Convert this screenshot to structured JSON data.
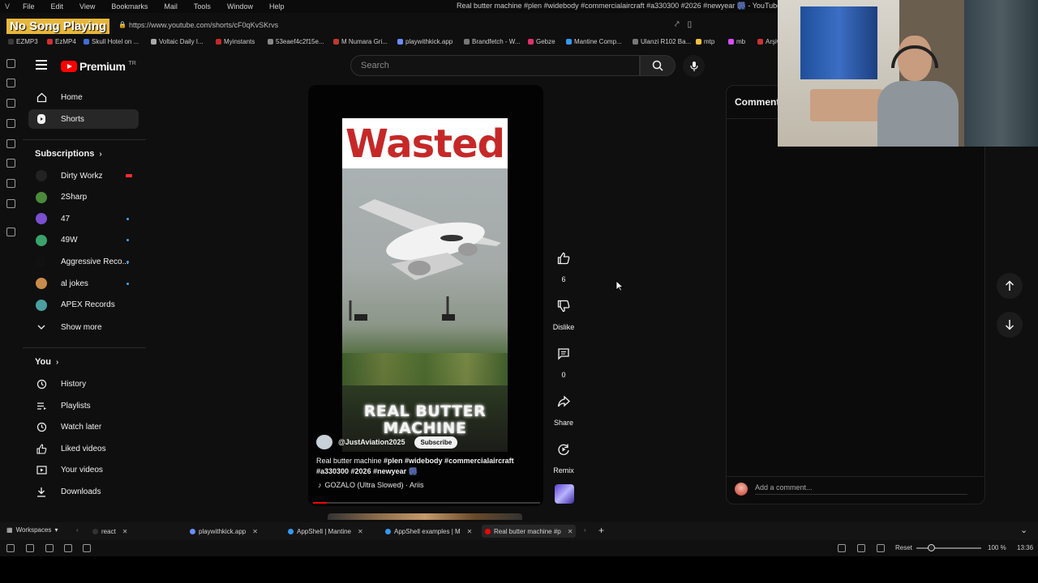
{
  "browser": {
    "menu": [
      "File",
      "Edit",
      "View",
      "Bookmarks",
      "Mail",
      "Tools",
      "Window",
      "Help"
    ],
    "window_title": "Real butter machine #plen #widebody #commercialaircraft #a330300 #2026 #newyear 🎆 - YouTube",
    "url": "https://www.youtube.com/shorts/cF0qKvSKrvs",
    "overlay_badge": "No Song Playing",
    "bookmarks": [
      {
        "label": "EZMP3",
        "color": "#3a3a3a"
      },
      {
        "label": "EzMP4",
        "color": "#d32f2f"
      },
      {
        "label": "Skull Hotel on ...",
        "color": "#3e6fd8"
      },
      {
        "label": "Voltaic Daily I...",
        "color": "#aaaaaa"
      },
      {
        "label": "Myinstants",
        "color": "#c62828"
      },
      {
        "label": "53eaef4c2f15e...",
        "color": "#888888"
      },
      {
        "label": "M Numara Gri...",
        "color": "#c0392b"
      },
      {
        "label": "playwithkick.app",
        "color": "#6a8cff"
      },
      {
        "label": "Brandfetch - W...",
        "color": "#777777"
      },
      {
        "label": "Gebze",
        "color": "#e1306c"
      },
      {
        "label": "Mantine Comp...",
        "color": "#339af0"
      },
      {
        "label": "Ulanzi R102 Ba...",
        "color": "#777777"
      },
      {
        "label": "mtp",
        "color": "#f0c040"
      },
      {
        "label": "mb",
        "color": "#d94dff"
      },
      {
        "label": "Arşiv",
        "color": "#cc3333"
      }
    ]
  },
  "youtube": {
    "logo_text": "Premium",
    "logo_region": "TR",
    "search_placeholder": "Search",
    "nav_main": [
      {
        "label": "Home",
        "icon": "home-icon"
      },
      {
        "label": "Shorts",
        "icon": "shorts-icon"
      }
    ],
    "subscriptions_title": "Subscriptions",
    "subscriptions": [
      {
        "label": "Dirty Workz",
        "color": "#222222",
        "badge": "live"
      },
      {
        "label": "2Sharp",
        "color": "#4a8a3a",
        "badge": ""
      },
      {
        "label": "47",
        "color": "#7a4fd0",
        "badge": "new"
      },
      {
        "label": "49W",
        "color": "#3aa36b",
        "badge": "new"
      },
      {
        "label": "Aggressive Reco...",
        "color": "#111111",
        "badge": "new"
      },
      {
        "label": "al jokes",
        "color": "#c98b4a",
        "badge": "new"
      },
      {
        "label": "APEX Records",
        "color": "#4aa0a0",
        "badge": ""
      }
    ],
    "show_more": "Show more",
    "you_title": "You",
    "you_items": [
      {
        "label": "History",
        "icon": "history-icon"
      },
      {
        "label": "Playlists",
        "icon": "playlists-icon"
      },
      {
        "label": "Watch later",
        "icon": "watch-later-icon"
      },
      {
        "label": "Liked videos",
        "icon": "liked-videos-icon"
      },
      {
        "label": "Your videos",
        "icon": "your-videos-icon"
      },
      {
        "label": "Downloads",
        "icon": "downloads-icon"
      }
    ]
  },
  "short": {
    "overlay_top": "Wasted",
    "overlay_bottom": "REAL BUTTER MACHINE",
    "channel": "@JustAviation2025",
    "subscribe": "Subscribe",
    "title_plain": "Real butter machine ",
    "title_tags": "#plen #widebody #commercialaircraft #a330300 #2026 #newyear 🎆",
    "music": "GOZALO (Ultra Slowed) · Ariis",
    "progress_fraction": 0.06,
    "actions": {
      "like_count": "6",
      "dislike": "Dislike",
      "comments_count": "0",
      "share": "Share",
      "remix": "Remix"
    }
  },
  "comments_panel": {
    "title": "Comments",
    "placeholder": "Add a comment..."
  },
  "tabs": {
    "workspaces": "Workspaces",
    "items": [
      {
        "label": "react",
        "color": "#333333",
        "active": false
      },
      {
        "label": "playwithkick.app",
        "color": "#6a8cff",
        "active": false
      },
      {
        "label": "AppShell | Mantine",
        "color": "#339af0",
        "active": false
      },
      {
        "label": "AppShell examples | M",
        "color": "#339af0",
        "active": false
      },
      {
        "label": "Real butter machine #p",
        "color": "#ff0000",
        "active": true
      }
    ]
  },
  "status": {
    "reset": "Reset",
    "zoom": "100 %",
    "time": "13:36"
  }
}
